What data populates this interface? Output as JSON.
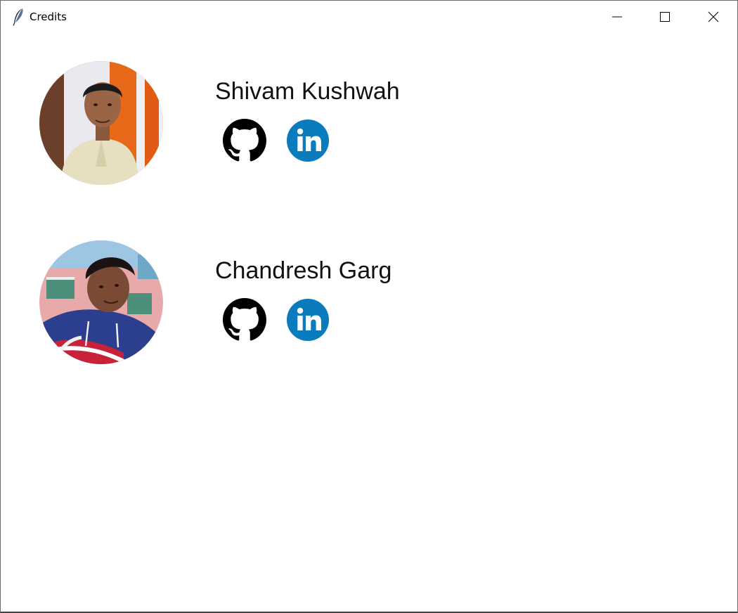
{
  "window": {
    "title": "Credits",
    "icon": "feather-icon"
  },
  "people": [
    {
      "name": "Shivam Kushwah",
      "links": [
        "github-icon",
        "linkedin-icon"
      ]
    },
    {
      "name": "Chandresh Garg",
      "links": [
        "github-icon",
        "linkedin-icon"
      ]
    }
  ],
  "colors": {
    "linkedin": "#0a7bbd",
    "github": "#000000"
  }
}
